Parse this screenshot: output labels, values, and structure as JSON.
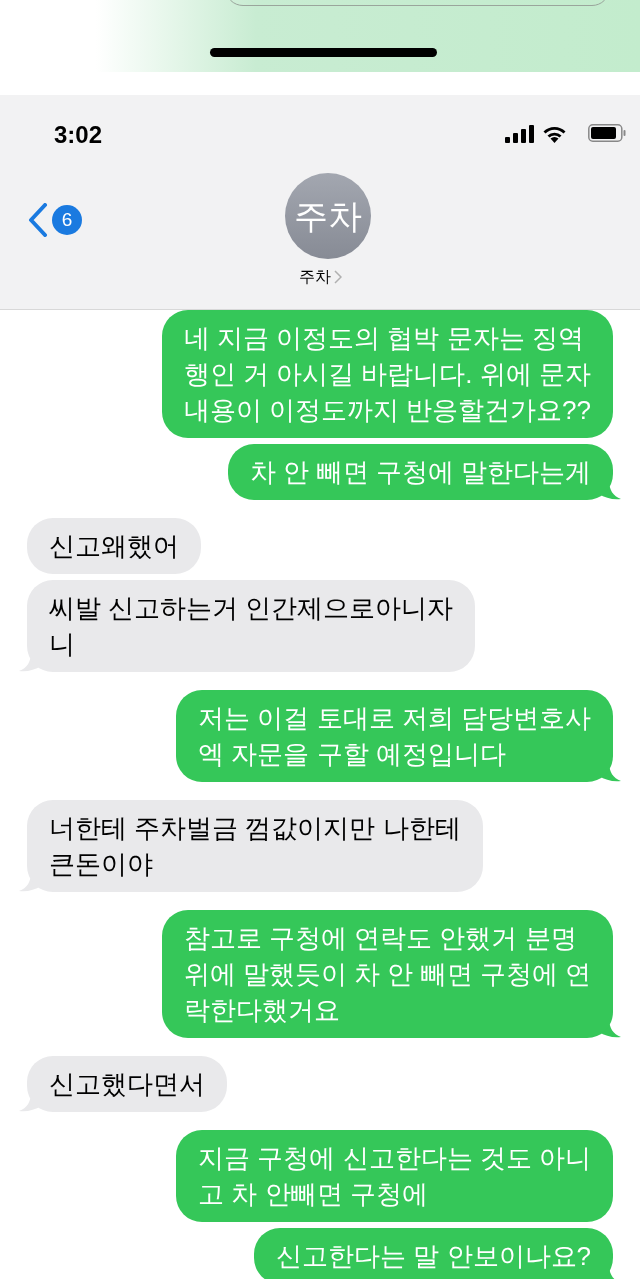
{
  "status_bar": {
    "time": "3:02"
  },
  "header": {
    "back_badge": "6",
    "avatar_initials": "주차",
    "contact_name": "주차"
  },
  "messages": [
    {
      "kind": "sent",
      "lines": [
        "네 지금 이정도의 협박 문자는 징역",
        "행인 거 아시길 바랍니다. 위에 문자",
        "내용이 이정도까지 반응할건가요??"
      ]
    },
    {
      "kind": "sent",
      "lines": [
        "차 안 빼면 구청에 말한다는게"
      ]
    },
    {
      "kind": "received",
      "lines": [
        "신고왜했어"
      ]
    },
    {
      "kind": "received",
      "lines": [
        "씨발 신고하는거 인간제으로아니자",
        "니"
      ]
    },
    {
      "kind": "sent",
      "lines": [
        "저는 이걸 토대로 저희 담당변호사",
        "엑 자문을 구할 예정입니다"
      ]
    },
    {
      "kind": "received",
      "lines": [
        "너한테 주차벌금 껌값이지만 나한테",
        "큰돈이야"
      ]
    },
    {
      "kind": "sent",
      "lines": [
        "참고로 구청에 연락도 안했거 분명",
        "위에 말했듯이 차 안 빼면 구청에 연",
        "락한다했거요"
      ]
    },
    {
      "kind": "received",
      "lines": [
        "신고했다면서"
      ]
    },
    {
      "kind": "sent",
      "lines": [
        "지금 구청에 신고한다는 것도 아니",
        "고 차 안빼면 구청에"
      ]
    },
    {
      "kind": "sent",
      "lines": [
        "신고한다는 말 안보이나요?"
      ]
    }
  ]
}
